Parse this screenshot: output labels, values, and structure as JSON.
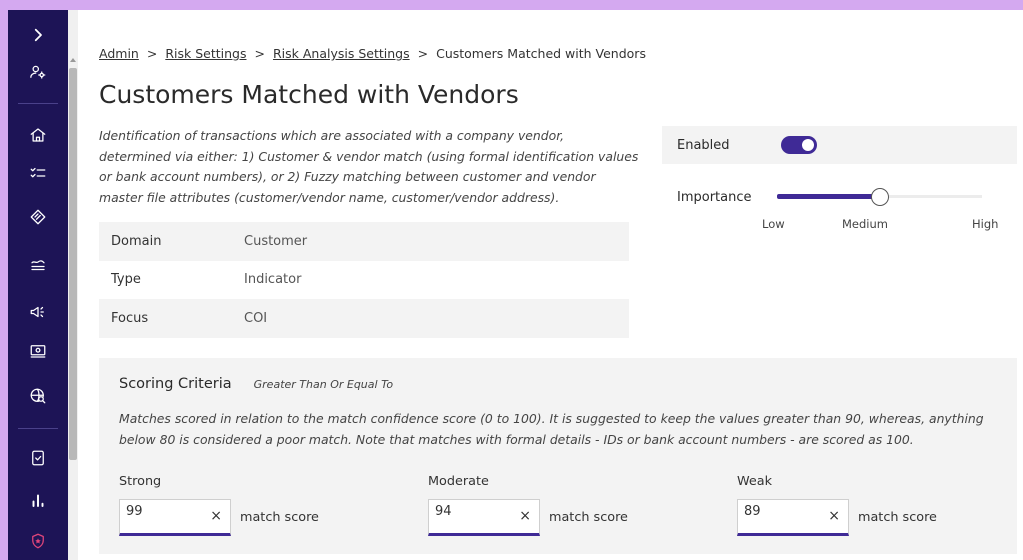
{
  "breadcrumb": {
    "items": [
      "Admin",
      "Risk Settings",
      "Risk Analysis Settings",
      "Customers Matched with Vendors"
    ],
    "separator": ">"
  },
  "page": {
    "title": "Customers Matched with Vendors",
    "description": "Identification of transactions which are associated with a company vendor, determined via either: 1) Customer & vendor match (using formal identification values or bank account numbers), or 2) Fuzzy matching between customer and vendor master file attributes (customer/vendor name, customer/vendor address)."
  },
  "meta": [
    {
      "key": "Domain",
      "value": "Customer"
    },
    {
      "key": "Type",
      "value": "Indicator"
    },
    {
      "key": "Focus",
      "value": "COI"
    }
  ],
  "settings": {
    "enabled_label": "Enabled",
    "enabled": true,
    "importance_label": "Importance",
    "importance_level": 0.5,
    "importance_options": [
      "Low",
      "Medium",
      "High"
    ],
    "importance_selected": "Medium"
  },
  "scoring": {
    "title": "Scoring Criteria",
    "subtitle": "Greater Than Or Equal To",
    "description": "Matches scored in relation to the match confidence score (0 to 100). It is suggested to keep the values greater than 90, whereas, anything below 80 is considered a poor match. Note that matches with formal details - IDs or bank account numbers - are scored as 100.",
    "criteria": [
      {
        "label": "Strong",
        "value": "99",
        "suffix": "match score"
      },
      {
        "label": "Moderate",
        "value": "94",
        "suffix": "match score"
      },
      {
        "label": "Weak",
        "value": "89",
        "suffix": "match score"
      }
    ],
    "clear_glyph": "×"
  },
  "sidebar": {
    "icons": [
      "chevron-right-icon",
      "user-settings-icon",
      "home-icon",
      "checklist-icon",
      "tag-icon",
      "approx-icon",
      "megaphone-icon",
      "cash-icon",
      "globe-search-icon",
      "document-check-icon",
      "bar-chart-icon",
      "shield-star-icon"
    ]
  },
  "colors": {
    "sidebar": "#1d1456",
    "accent": "#3f2a96",
    "frame": "#d4a9f0",
    "shield": "#e0457a"
  }
}
